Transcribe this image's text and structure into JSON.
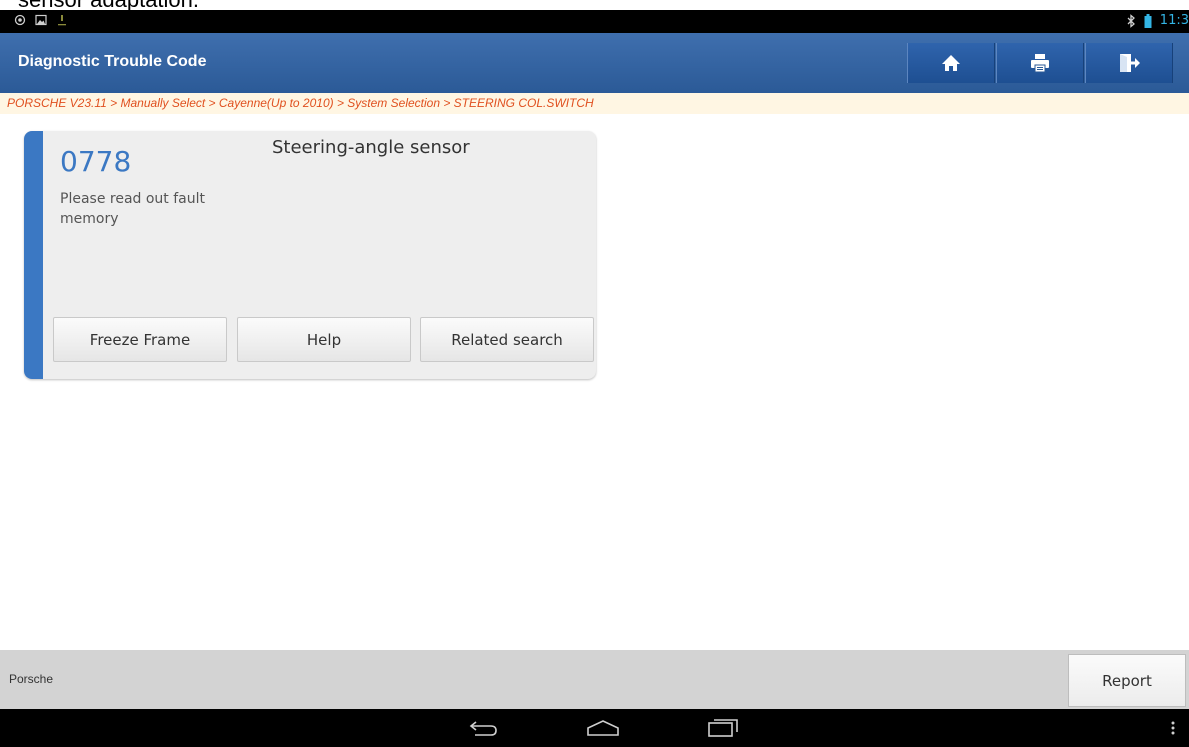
{
  "caption": {
    "text": "sensor adaptation."
  },
  "status_bar": {
    "time": "11:3",
    "left_icons": [
      "location-icon",
      "image-icon",
      "download-icon"
    ],
    "right_icons": [
      "bluetooth-icon",
      "battery-icon"
    ]
  },
  "header": {
    "title": "Diagnostic Trouble Code",
    "buttons": [
      "home",
      "print",
      "exit"
    ]
  },
  "breadcrumb": "PORSCHE V23.11 > Manually Select > Cayenne(Up to 2010) > System Selection > STEERING COL.SWITCH",
  "dtc": {
    "code": "0778",
    "description": "Please read out fault memory",
    "name": "Steering-angle sensor",
    "buttons": {
      "freeze_frame": "Freeze Frame",
      "help": "Help",
      "related_search": "Related search"
    }
  },
  "footer": {
    "brand": "Porsche",
    "report": "Report"
  },
  "colors": {
    "header_blue": "#2b5a97",
    "accent_blue": "#3b78c3",
    "breadcrumb_orange": "#e0501f",
    "time_blue": "#33b5e5"
  }
}
